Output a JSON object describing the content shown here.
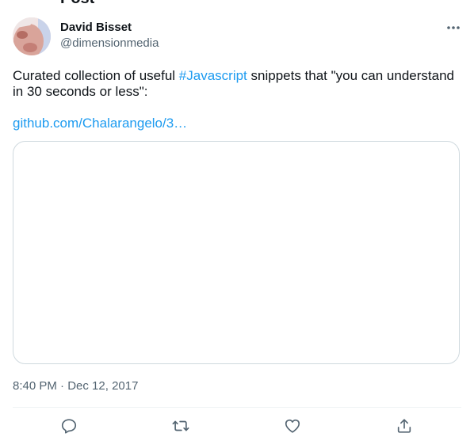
{
  "header": {
    "partial_title": "Post"
  },
  "author": {
    "name": "David Bisset",
    "handle": "@dimensionmedia"
  },
  "tweet": {
    "text_before": "Curated collection of useful ",
    "hashtag": "#Javascript",
    "text_after": " snippets that \"you can understand in 30 seconds or less\":",
    "link": "github.com/Chalarangelo/3…",
    "time": "8:40 PM",
    "separator": "·",
    "date": "Dec 12, 2017"
  },
  "icons": {
    "more": "more-horizontal-icon",
    "reply": "reply-bubble-icon",
    "retweet": "retweet-icon",
    "like": "heart-icon",
    "share": "share-upload-icon"
  },
  "colors": {
    "text": "#0f1419",
    "secondary": "#536471",
    "link": "#1d9bf0",
    "border": "#cfd9de"
  }
}
